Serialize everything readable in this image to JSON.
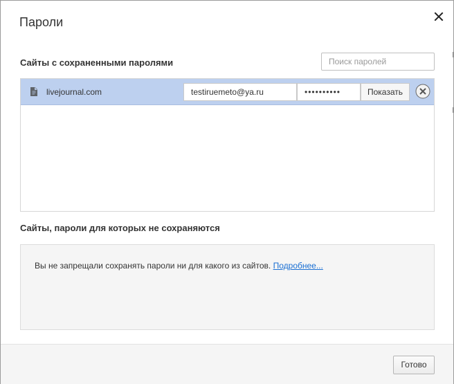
{
  "dialog": {
    "title": "Пароли",
    "close_icon": "close-icon"
  },
  "saved": {
    "section_title": "Сайты с сохраненными паролями",
    "search_placeholder": "Поиск паролей",
    "rows": [
      {
        "site": "livejournal.com",
        "icon": "document-icon",
        "username": "testiruemeto@ya.ru",
        "password_masked": "••••••••••",
        "show_label": "Показать",
        "remove_icon": "remove-circle-icon"
      }
    ]
  },
  "exceptions": {
    "section_title": "Сайты, пароли для которых не сохраняются",
    "empty_text": "Вы не запрещали сохранять пароли ни для какого из сайтов.",
    "more_link": "Подробнее..."
  },
  "footer": {
    "done_label": "Готово"
  },
  "colors": {
    "selected_row": "#bdd0ef",
    "link": "#1a6fd3",
    "panel_bg": "#f5f5f5"
  }
}
